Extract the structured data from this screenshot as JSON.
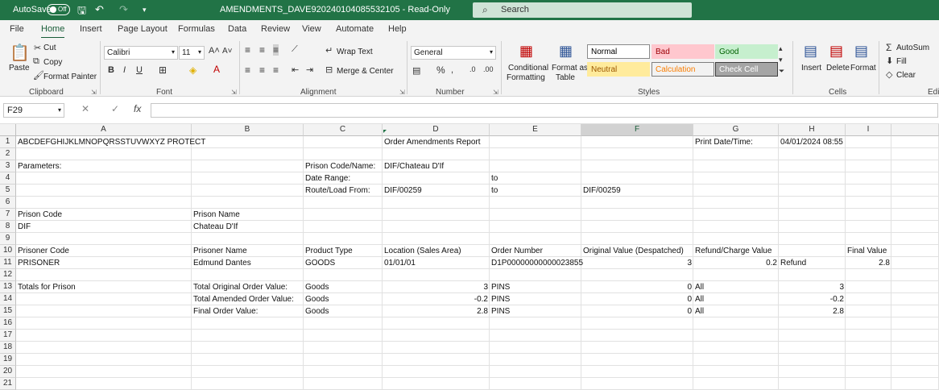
{
  "titlebar": {
    "autosave_label": "AutoSave",
    "autosave_state": "Off",
    "file_title": "AMENDMENTS_DAVE920240104085532105 - Read-Only",
    "search_placeholder": "Search"
  },
  "menu": {
    "tabs": [
      "File",
      "Home",
      "Insert",
      "Page Layout",
      "Formulas",
      "Data",
      "Review",
      "View",
      "Automate",
      "Help"
    ],
    "active": "Home"
  },
  "ribbon": {
    "clipboard": {
      "paste": "Paste",
      "cut": "Cut",
      "copy": "Copy",
      "format_painter": "Format Painter",
      "label": "Clipboard"
    },
    "font": {
      "name": "Calibri",
      "size": "11",
      "bold": "B",
      "italic": "I",
      "underline": "U",
      "label": "Font"
    },
    "alignment": {
      "wrap_text": "Wrap Text",
      "merge_center": "Merge & Center",
      "label": "Alignment"
    },
    "number": {
      "format": "General",
      "label": "Number"
    },
    "styles": {
      "conditional": [
        "Conditional",
        "Formatting"
      ],
      "format_as_table": [
        "Format as",
        "Table"
      ],
      "boxes": [
        {
          "name": "Normal",
          "bg": "#ffffff",
          "fg": "#000000",
          "border": "#8a8a8a"
        },
        {
          "name": "Bad",
          "bg": "#ffc7ce",
          "fg": "#9c0006",
          "border": "#ffc7ce"
        },
        {
          "name": "Good",
          "bg": "#c6efce",
          "fg": "#006100",
          "border": "#c6efce"
        },
        {
          "name": "Neutral",
          "bg": "#ffeb9c",
          "fg": "#9c5700",
          "border": "#ffeb9c"
        },
        {
          "name": "Calculation",
          "bg": "#f2f2f2",
          "fg": "#fa7d00",
          "border": "#7f7f7f"
        },
        {
          "name": "Check Cell",
          "bg": "#a5a5a5",
          "fg": "#ffffff",
          "border": "#3f3f3f"
        }
      ],
      "label": "Styles"
    },
    "cells": {
      "insert": "Insert",
      "delete": "Delete",
      "format": "Format",
      "label": "Cells"
    },
    "editing": {
      "autosum": "AutoSum",
      "fill": "Fill",
      "clear": "Clear",
      "label": "Edi"
    }
  },
  "formula_bar": {
    "name_box": "F29",
    "fx": "fx",
    "value": ""
  },
  "grid": {
    "columns": [
      "A",
      "B",
      "C",
      "D",
      "E",
      "F",
      "G",
      "H",
      "I",
      "J"
    ],
    "selected_column": "F",
    "rows": [
      "1",
      "2",
      "3",
      "4",
      "5",
      "6",
      "7",
      "8",
      "9",
      "10",
      "11",
      "12",
      "13",
      "14",
      "15",
      "16",
      "17",
      "18",
      "19",
      "20",
      "21"
    ],
    "cells": {
      "A1": "ABCDEFGHIJKLMNOPQRSSTUVWXYZ PROTECT",
      "D1": "Order Amendments Report",
      "G1": "Print Date/Time:",
      "H1": "04/01/2024 08:55",
      "A3": "Parameters:",
      "C3": "Prison Code/Name:",
      "D3": "DIF/Chateau D'If",
      "C4": "Date Range:",
      "E4": "to",
      "C5": "Route/Load From:",
      "D5": "DIF/00259",
      "E5": "to",
      "F5": "DIF/00259",
      "A7": "Prison Code",
      "B7": "Prison Name",
      "A8": "DIF",
      "B8": "Chateau D'If",
      "A10": "Prisoner Code",
      "B10": "Prisoner Name",
      "C10": "Product Type",
      "D10": "Location (Sales Area)",
      "E10": "Order Number",
      "F10": "Original Value (Despatched)",
      "G10": "Refund/Charge Value",
      "I10": "Final Value",
      "A11": "PRISONER",
      "B11": "Edmund Dantes",
      "C11": "GOODS",
      "D11": "01/01/01",
      "E11": "D1P00000000000023855",
      "F11": "3",
      "G11": "0.2",
      "H11": "Refund",
      "I11": "2.8",
      "A13": "Totals for Prison",
      "B13": "Total Original Order Value:",
      "C13": "Goods",
      "D13": "3",
      "E13": "PINS",
      "F13": "0",
      "G13": "All",
      "H13": "3",
      "B14": "Total Amended Order Value:",
      "C14": "Goods",
      "D14": "-0.2",
      "E14": "PINS",
      "F14": "0",
      "G14": "All",
      "H14": "-0.2",
      "B15": "Final Order Value:",
      "C15": "Goods",
      "D15": "2.8",
      "E15": "PINS",
      "F15": "0",
      "G15": "All",
      "H15": "2.8"
    }
  }
}
